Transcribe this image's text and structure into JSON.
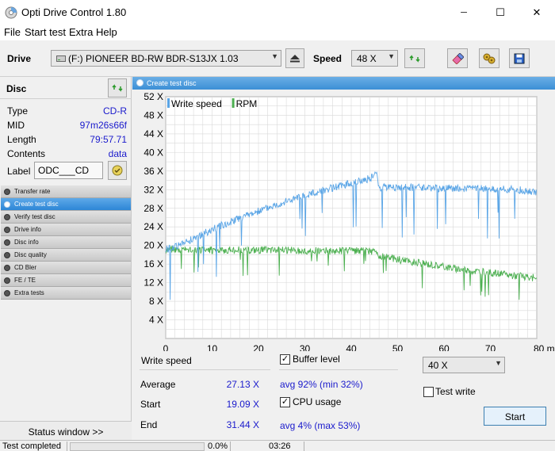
{
  "app": {
    "title": "Opti Drive Control 1.80"
  },
  "window_controls": {
    "minimize": "─",
    "maximize": "☐",
    "close": "✕"
  },
  "menu": {
    "items": [
      "File",
      "Start test",
      "Extra",
      "Help"
    ]
  },
  "toolbar": {
    "drive_label": "Drive",
    "drive_value": "(F:)   PIONEER BD-RW   BDR-S13JX 1.03",
    "speed_label": "Speed",
    "speed_value": "48 X",
    "icons": [
      "drive-refresh-icon",
      "eject-icon",
      "speed-refresh-icon",
      "erase-icon",
      "settings-icon",
      "save-icon"
    ]
  },
  "disc": {
    "title": "Disc",
    "fields": [
      {
        "label": "Type",
        "value": "CD-R"
      },
      {
        "label": "MID",
        "value": "97m26s66f"
      },
      {
        "label": "Length",
        "value": "79:57.71"
      },
      {
        "label": "Contents",
        "value": "data"
      }
    ],
    "label_label": "Label",
    "label_value": "ODC___CD"
  },
  "nav": {
    "items": [
      "Transfer rate",
      "Create test disc",
      "Verify test disc",
      "Drive info",
      "Disc info",
      "Disc quality",
      "CD Bler",
      "FE / TE",
      "Extra tests"
    ],
    "active": "Create test disc"
  },
  "status_window_label": "Status window >>",
  "panel": {
    "title": "Create test disc"
  },
  "chart_data": {
    "type": "line",
    "legend": [
      "Write speed",
      "RPM"
    ],
    "x_ticks": [
      "0",
      "10",
      "20",
      "30",
      "40",
      "50",
      "60",
      "70",
      "80 min"
    ],
    "y_ticks": [
      "4 X",
      "8 X",
      "12 X",
      "16 X",
      "20 X",
      "24 X",
      "28 X",
      "32 X",
      "36 X",
      "40 X",
      "44 X",
      "48 X",
      "52 X"
    ],
    "xlim": [
      0,
      80
    ],
    "ylim": [
      0,
      52
    ],
    "grid": true,
    "colors": {
      "write_speed": "#5aa5e6",
      "rpm": "#4caf50",
      "plot_bg": "#ffffff",
      "grid": "#d9d9d9"
    },
    "series": [
      {
        "name": "Write speed",
        "x": [
          0,
          2,
          4,
          6,
          8,
          10,
          12,
          14,
          16,
          18,
          20,
          22,
          24,
          26,
          28,
          30,
          32,
          34,
          36,
          38,
          40,
          42,
          44,
          45.5,
          46,
          50,
          55,
          60,
          65,
          70,
          75,
          80
        ],
        "values": [
          19.1,
          19.8,
          20.6,
          21.5,
          22.5,
          23.4,
          24.3,
          25.1,
          25.9,
          26.7,
          27.4,
          28.1,
          28.8,
          29.5,
          30.1,
          30.7,
          31.3,
          31.9,
          32.4,
          32.9,
          33.4,
          33.9,
          34.4,
          35.5,
          32.5,
          32.5,
          32.4,
          32.3,
          32.3,
          32.2,
          32.1,
          31.4
        ]
      },
      {
        "name": "RPM",
        "x": [
          0,
          10,
          20,
          30,
          40,
          45.5,
          46,
          50,
          55,
          60,
          65,
          70,
          75,
          80
        ],
        "values": [
          19.2,
          19.0,
          19.0,
          18.9,
          18.8,
          18.8,
          17.8,
          17.0,
          16.2,
          15.4,
          14.7,
          14.1,
          13.5,
          13.0
        ]
      }
    ]
  },
  "stats": {
    "write_speed_label": "Write speed",
    "average_label": "Average",
    "average_value": "27.13 X",
    "start_label": "Start",
    "start_value": "19.09 X",
    "end_label": "End",
    "end_value": "31.44 X",
    "buffer_level_label": "Buffer level",
    "buffer_level_checked": true,
    "buffer_level_value": "avg 92% (min 32%)",
    "cpu_usage_label": "CPU usage",
    "cpu_usage_checked": true,
    "cpu_usage_value": "avg 4% (max 53%)",
    "write_speed_select": "40 X",
    "test_write_label": "Test write",
    "test_write_checked": false,
    "start_button": "Start"
  },
  "statusbar": {
    "status": "Test completed",
    "progress": "0.0%",
    "time": "03:26"
  }
}
